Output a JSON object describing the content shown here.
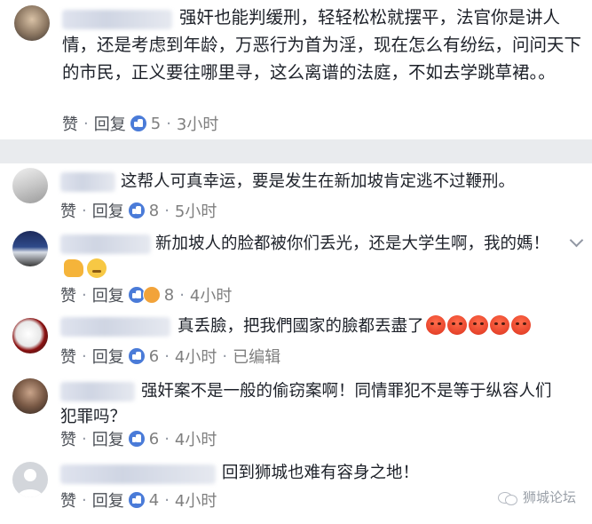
{
  "actions": {
    "like": "赞",
    "reply": "回复",
    "separator": "·",
    "edited": "已编辑"
  },
  "comments": [
    {
      "text": "强奸也能判缓刑，轻轻松松就摆平，法官你是讲人情，还是考虑到年龄，万恶行为首为淫，现在怎么有纷纭，问问天下的市民，正义要往哪里寻，这么离谱的法庭，不如去学跳草裙。。",
      "likes": "5",
      "time": "3小时"
    },
    {
      "text": "这帮人可真幸运，要是发生在新加坡肯定逃不过鞭刑。",
      "likes": "8",
      "time": "5小时"
    },
    {
      "text": "新加坡人的脸都被你们丢光，还是大学生啊，我的媽！",
      "likes": "8",
      "time": "4小时"
    },
    {
      "text": "真丢臉，把我們國家的臉都丟盡了",
      "likes": "6",
      "time": "4小时"
    },
    {
      "text": "强奸案不是一般的偷窃案啊！同情罪犯不是等于纵容人们犯罪吗？",
      "likes": "6",
      "time": "4小时"
    },
    {
      "text": "回到狮城也难有容身之地！",
      "likes": "4",
      "time": "4小时"
    }
  ],
  "watermark": "狮城论坛",
  "colors": {
    "like_blue": "#4a7bd8",
    "action_gray": "#7f7f7f",
    "divider": "#e9ebee"
  }
}
